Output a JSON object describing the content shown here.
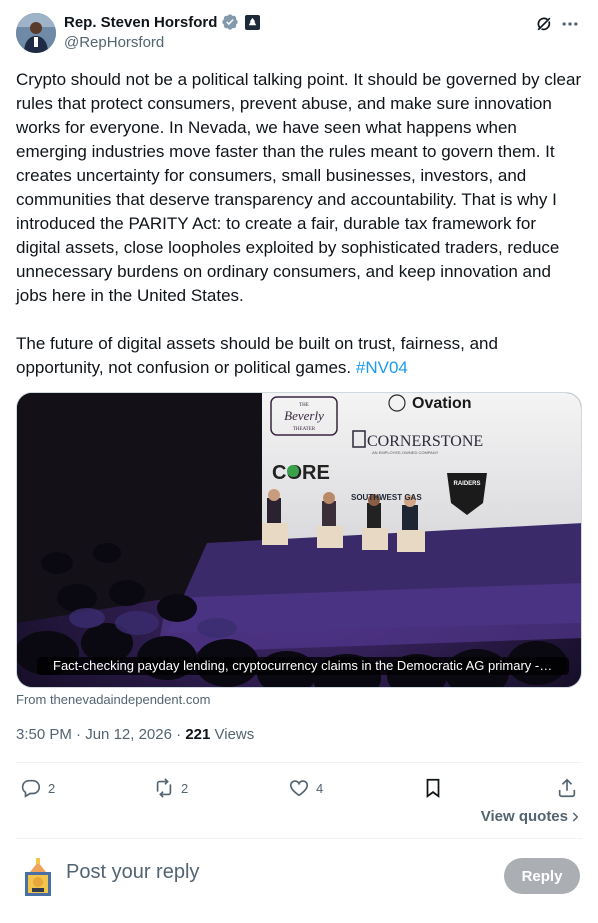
{
  "author": {
    "display_name": "Rep. Steven Horsford",
    "handle": "@RepHorsford",
    "avatar_icon": "person-avatar",
    "verified_icon": "verified-badge-icon",
    "affiliation_icon": "government-badge-icon"
  },
  "header_actions": {
    "grok_icon": "grok-icon",
    "more_icon": "more-options-icon"
  },
  "tweet": {
    "paragraph1": "Crypto should not be a political talking point. It should be governed by clear rules that protect consumers, prevent abuse, and make sure innovation works for everyone. In Nevada, we have seen what happens when emerging industries move faster than the rules meant to govern them. It creates uncertainty for consumers, small businesses, investors, and communities that deserve transparency and accountability. That is why I introduced the PARITY Act: to create a fair, durable tax framework for digital assets, close loopholes exploited by sophisticated traders, reduce unnecessary burdens on ordinary consumers, and keep innovation and jobs here in the United States.",
    "paragraph2": "The future of digital assets should be built on trust, fairness, and opportunity, not confusion or political games.",
    "hashtag": "#NV04"
  },
  "card": {
    "caption": "Fact-checking payday lending, cryptocurrency claims in the Democratic AG primary - ...",
    "source": "From thenevadaindependent.com",
    "screen_logos": {
      "beverly_top": "THE",
      "beverly": "Beverly",
      "beverly_bottom": "THEATER",
      "ovation": "Ovation",
      "cornerstone": "CORNERSTONE",
      "cornerstone_sub": "AN EMPLOYEE-OWNED COMPANY",
      "core": "CORE",
      "southwest": "SOUTHWEST GAS",
      "raiders": "RAIDERS"
    }
  },
  "meta": {
    "time": "3:50 PM",
    "separator": "·",
    "date": "Jun 12, 2026",
    "views_count": "221",
    "views_label": "Views"
  },
  "actions": {
    "reply_count": "2",
    "repost_count": "2",
    "like_count": "4",
    "reply_icon": "reply-icon",
    "repost_icon": "repost-icon",
    "like_icon": "heart-icon",
    "bookmark_icon": "bookmark-icon",
    "share_icon": "share-icon"
  },
  "view_quotes": {
    "label": "View quotes"
  },
  "reply": {
    "placeholder": "Post your reply",
    "button_label": "Reply"
  }
}
